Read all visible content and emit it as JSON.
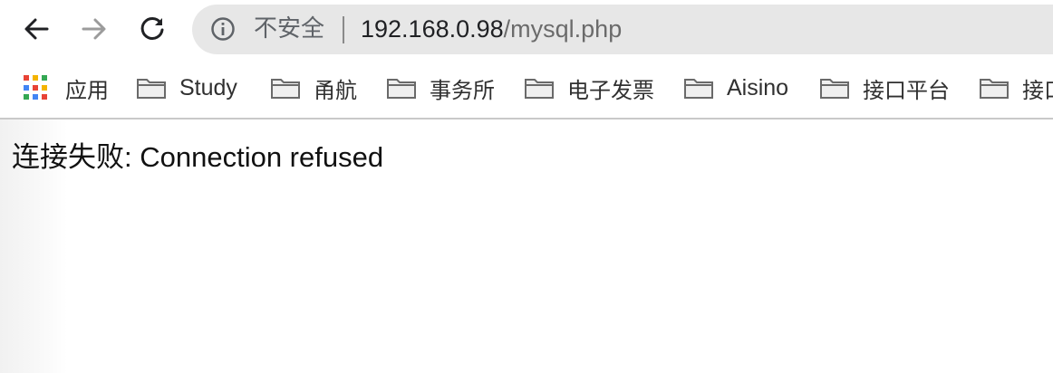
{
  "toolbar": {
    "back_icon": "arrow-left-icon",
    "forward_icon": "arrow-right-icon",
    "reload_icon": "reload-icon"
  },
  "omnibox": {
    "security_icon": "info-icon",
    "security_label": "不安全",
    "url_host": "192.168.0.98",
    "url_path": "/mysql.php"
  },
  "bookmarks": {
    "apps_label": "应用",
    "items": [
      {
        "label": "Study"
      },
      {
        "label": "甬航"
      },
      {
        "label": "事务所"
      },
      {
        "label": "电子发票"
      },
      {
        "label": "Aisino"
      },
      {
        "label": "接口平台"
      },
      {
        "label": "接口"
      }
    ]
  },
  "page": {
    "message": "连接失败: Connection refused"
  },
  "colors": {
    "omnibox_bg": "#e7e7e7",
    "text": "#202124",
    "muted": "#5f6368"
  }
}
